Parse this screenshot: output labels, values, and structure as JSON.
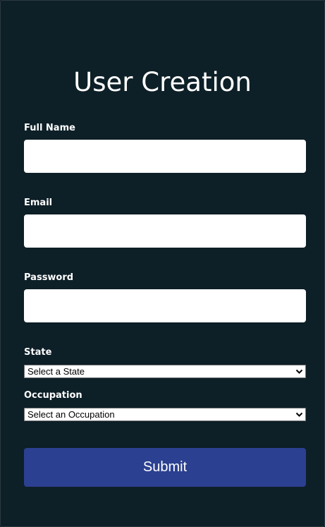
{
  "form": {
    "title": "User Creation",
    "full_name": {
      "label": "Full Name",
      "value": "",
      "placeholder": ""
    },
    "email": {
      "label": "Email",
      "value": "",
      "placeholder": ""
    },
    "password": {
      "label": "Password",
      "value": "",
      "placeholder": ""
    },
    "state": {
      "label": "State",
      "selected": "Select a State"
    },
    "occupation": {
      "label": "Occupation",
      "selected": "Select an Occupation"
    },
    "submit_label": "Submit"
  },
  "colors": {
    "background": "#0d1f27",
    "submit_button": "#2b4090",
    "input_background": "#ffffff",
    "text": "#ffffff"
  },
  "icons": {
    "select_chevron": "chevron-down-icon"
  }
}
